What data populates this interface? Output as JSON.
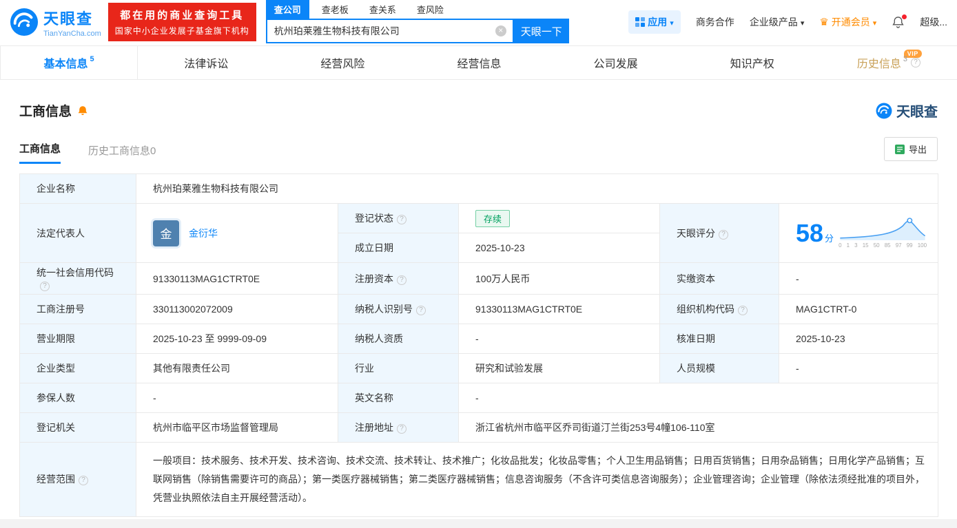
{
  "header": {
    "logo": {
      "brand": "天眼查",
      "domain": "TianYanCha.com"
    },
    "banner": {
      "line1": "都在用的商业查询工具",
      "line2": "国家中小企业发展子基金旗下机构"
    },
    "search_tabs": [
      {
        "label": "查公司"
      },
      {
        "label": "查老板"
      },
      {
        "label": "查关系"
      },
      {
        "label": "查风险"
      }
    ],
    "search": {
      "value": "杭州珀莱雅生物科技有限公司",
      "button": "天眼一下"
    },
    "menu": {
      "apps": "应用",
      "cooperation": "商务合作",
      "enterprise": "企业级产品",
      "vip": "开通会员",
      "super": "超级..."
    }
  },
  "nav_tabs": [
    {
      "label": "基本信息",
      "count": "5"
    },
    {
      "label": "法律诉讼"
    },
    {
      "label": "经营风险"
    },
    {
      "label": "经营信息"
    },
    {
      "label": "公司发展"
    },
    {
      "label": "知识产权"
    },
    {
      "label": "历史信息",
      "count": "3",
      "badge": "VIP"
    }
  ],
  "section": {
    "title": "工商信息",
    "watermark": "天眼查",
    "subtabs": [
      {
        "label": "工商信息"
      },
      {
        "label": "历史工商信息0"
      }
    ],
    "export_label": "导出"
  },
  "fields": {
    "company_name": {
      "label": "企业名称",
      "value": "杭州珀莱雅生物科技有限公司"
    },
    "legal_rep": {
      "label": "法定代表人",
      "value": "金衍华",
      "avatar": "金"
    },
    "reg_status": {
      "label": "登记状态",
      "value": "存续"
    },
    "establish_date": {
      "label": "成立日期",
      "value": "2025-10-23"
    },
    "score": {
      "label": "天眼评分",
      "value": "58",
      "unit": "分"
    },
    "credit_code": {
      "label": "统一社会信用代码",
      "value": "91330113MAG1CTRT0E"
    },
    "reg_capital": {
      "label": "注册资本",
      "value": "100万人民币"
    },
    "paid_capital": {
      "label": "实缴资本",
      "value": "-"
    },
    "reg_number": {
      "label": "工商注册号",
      "value": "330113002072009"
    },
    "taxpayer_id": {
      "label": "纳税人识别号",
      "value": "91330113MAG1CTRT0E"
    },
    "org_code": {
      "label": "组织机构代码",
      "value": "MAG1CTRT-0"
    },
    "business_term": {
      "label": "营业期限",
      "value": "2025-10-23 至 9999-09-09"
    },
    "taxpayer_quality": {
      "label": "纳税人资质",
      "value": "-"
    },
    "approval_date": {
      "label": "核准日期",
      "value": "2025-10-23"
    },
    "company_type": {
      "label": "企业类型",
      "value": "其他有限责任公司"
    },
    "industry": {
      "label": "行业",
      "value": "研究和试验发展"
    },
    "staff_size": {
      "label": "人员规模",
      "value": "-"
    },
    "insured_count": {
      "label": "参保人数",
      "value": "-"
    },
    "english_name": {
      "label": "英文名称",
      "value": "-"
    },
    "reg_authority": {
      "label": "登记机关",
      "value": "杭州市临平区市场监督管理局"
    },
    "reg_address": {
      "label": "注册地址",
      "value": "浙江省杭州市临平区乔司街道汀兰街253号4幢106-110室"
    },
    "business_scope": {
      "label": "经营范围",
      "value": "一般项目：技术服务、技术开发、技术咨询、技术交流、技术转让、技术推广；化妆品批发；化妆品零售；个人卫生用品销售；日用百货销售；日用杂品销售；日用化学产品销售；互联网销售（除销售需要许可的商品）；第一类医疗器械销售；第二类医疗器械销售；信息咨询服务（不含许可类信息咨询服务）；企业管理咨询；企业管理（除依法须经批准的项目外，凭营业执照依法自主开展经营活动）。"
    }
  },
  "score_chart": {
    "type": "area",
    "ticks": [
      "0",
      "1",
      "3",
      "15",
      "50",
      "85",
      "97",
      "99",
      "100"
    ]
  }
}
